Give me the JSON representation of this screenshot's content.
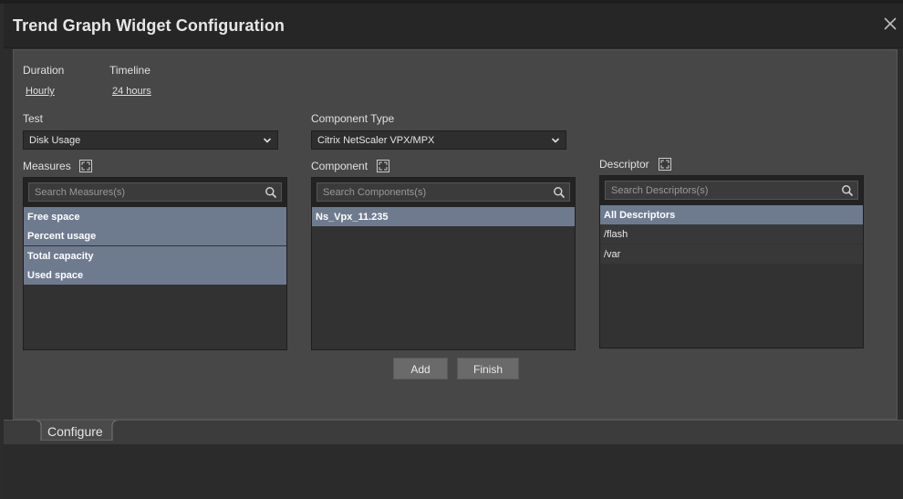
{
  "window": {
    "title": "Trend Graph Widget Configuration"
  },
  "duration": {
    "label": "Duration",
    "value": "Hourly"
  },
  "timeline": {
    "label": "Timeline",
    "value": "24 hours"
  },
  "test": {
    "label": "Test",
    "selected": "Disk Usage"
  },
  "component_type": {
    "label": "Component Type",
    "selected": "Citrix NetScaler VPX/MPX"
  },
  "measures": {
    "label": "Measures",
    "search_placeholder": "Search Measures(s)",
    "items": [
      "Free space",
      "Percent usage",
      "Total capacity",
      "Used space"
    ]
  },
  "component": {
    "label": "Component",
    "search_placeholder": "Search Components(s)",
    "items": [
      "Ns_Vpx_11.235"
    ]
  },
  "descriptor": {
    "label": "Descriptor",
    "search_placeholder": "Search Descriptors(s)",
    "items": [
      "All Descriptors",
      "/flash",
      "/var"
    ]
  },
  "buttons": {
    "add": "Add",
    "finish": "Finish"
  },
  "tabs": {
    "configure": "Configure"
  },
  "colors": {
    "selected_row": "#6e7b8f",
    "panel": "#474747",
    "button": "#6a6a6a"
  }
}
